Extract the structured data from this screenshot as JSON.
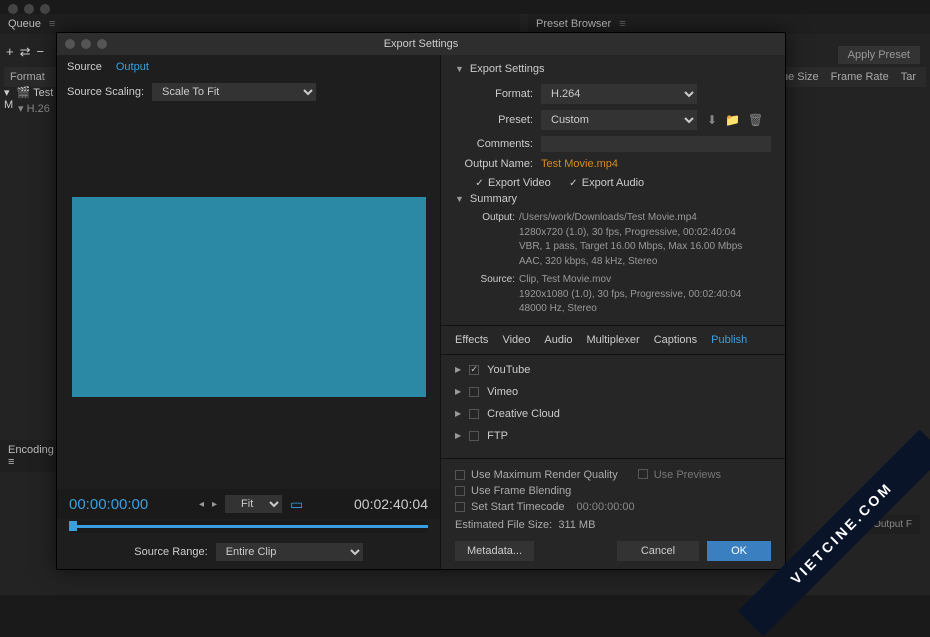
{
  "window": {
    "queue_title": "Queue",
    "preset_browser_title": "Preset Browser",
    "encoding_title": "Encoding"
  },
  "queue": {
    "cols": {
      "format": "Format",
      "frame_size": "Frame Size",
      "frame_rate": "Frame Rate",
      "target": "Tar"
    },
    "row_name": "Test M",
    "row_codec": "H.26",
    "apply_preset": "Apply Preset",
    "output_file": "Output F"
  },
  "modal": {
    "title": "Export Settings",
    "preview": {
      "tab_source": "Source",
      "tab_output": "Output",
      "scaling_label": "Source Scaling:",
      "scaling_value": "Scale To Fit",
      "time_in": "00:00:00:00",
      "time_out": "00:02:40:04",
      "fit": "Fit",
      "range_label": "Source Range:",
      "range_value": "Entire Clip"
    },
    "settings": {
      "header": "Export Settings",
      "format_label": "Format:",
      "format_value": "H.264",
      "preset_label": "Preset:",
      "preset_value": "Custom",
      "comments_label": "Comments:",
      "output_name_label": "Output Name:",
      "output_name_value": "Test Movie.mp4",
      "export_video": "Export Video",
      "export_audio": "Export Audio",
      "summary_header": "Summary",
      "summary_output_label": "Output:",
      "summary_output_line1": "/Users/work/Downloads/Test Movie.mp4",
      "summary_output_line2": "1280x720 (1.0), 30 fps, Progressive, 00:02:40:04",
      "summary_output_line3": "VBR, 1 pass, Target 16.00 Mbps, Max 16.00 Mbps",
      "summary_output_line4": "AAC, 320 kbps, 48 kHz, Stereo",
      "summary_source_label": "Source:",
      "summary_source_line1": "Clip, Test Movie.mov",
      "summary_source_line2": "1920x1080 (1.0), 30 fps, Progressive, 00:02:40:04",
      "summary_source_line3": "48000 Hz, Stereo"
    },
    "tabs": {
      "effects": "Effects",
      "video": "Video",
      "audio": "Audio",
      "multiplexer": "Multiplexer",
      "captions": "Captions",
      "publish": "Publish"
    },
    "publish": {
      "youtube": "YouTube",
      "vimeo": "Vimeo",
      "creative_cloud": "Creative Cloud",
      "ftp": "FTP"
    },
    "footer": {
      "max_render": "Use Maximum Render Quality",
      "use_previews": "Use Previews",
      "frame_blending": "Use Frame Blending",
      "start_timecode": "Set Start Timecode",
      "tc_value": "00:00:00:00",
      "est_label": "Estimated File Size:",
      "est_value": "311 MB",
      "metadata": "Metadata...",
      "cancel": "Cancel",
      "ok": "OK"
    }
  },
  "watermark": "VIETCINE.COM"
}
